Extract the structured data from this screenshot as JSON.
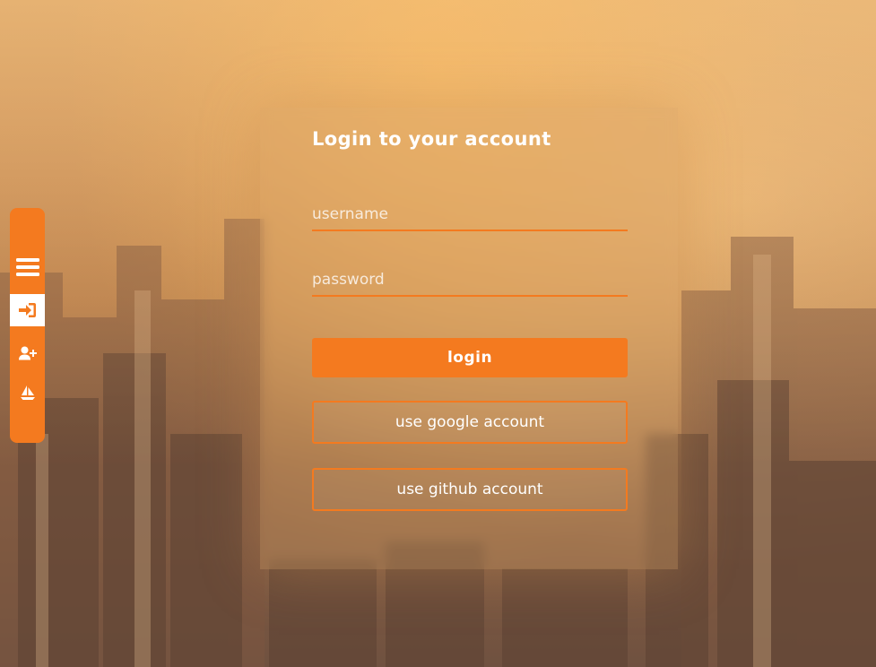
{
  "login": {
    "title": "Login to your account",
    "username_placeholder": "username",
    "password_placeholder": "password",
    "login_label": "login",
    "google_label": "use google account",
    "github_label": "use github account"
  },
  "sidebar": {
    "items": [
      {
        "icon": "menu-icon"
      },
      {
        "icon": "sign-in-icon",
        "active": true
      },
      {
        "icon": "user-plus-icon"
      },
      {
        "icon": "sailboat-icon"
      }
    ]
  },
  "colors": {
    "accent": "#f47a1f",
    "text": "#ffffff"
  }
}
